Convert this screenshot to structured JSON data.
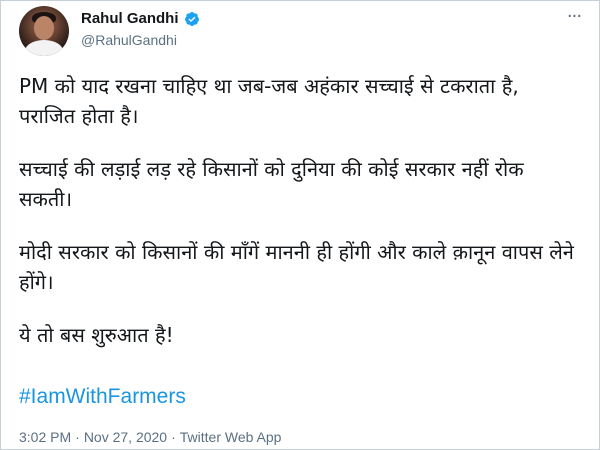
{
  "user": {
    "display_name": "Rahul Gandhi",
    "handle": "@RahulGandhi",
    "verified_icon": "verified-badge-icon",
    "avatar_icon": "profile-avatar"
  },
  "menu": {
    "more_icon": "more-options-icon",
    "glyph": "···"
  },
  "tweet": {
    "paragraphs": [
      "PM को याद रखना चाहिए था जब-जब अहंकार सच्चाई से टकराता है, पराजित होता है।",
      "सच्चाई की लड़ाई लड़ रहे किसानों को दुनिया की कोई सरकार नहीं रोक सकती।",
      "मोदी सरकार को किसानों की माँगें माननी ही होंगी और काले क़ानून वापस लेने होंगे।",
      "ये तो बस शुरुआत है!"
    ],
    "hashtag": "#IamWithFarmers"
  },
  "meta": {
    "time": "3:02 PM",
    "separator": "·",
    "date": "Nov 27, 2020",
    "source": "Twitter Web App"
  },
  "colors": {
    "link": "#1b95e0",
    "verified": "#1da1f2",
    "secondary_text": "#5b7083",
    "border": "#c4cfd6"
  }
}
